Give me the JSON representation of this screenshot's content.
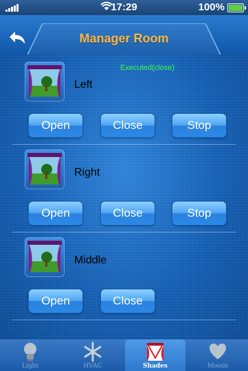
{
  "status_bar": {
    "time": "17:29",
    "battery": "100%"
  },
  "header": {
    "title": "Manager Room"
  },
  "status_message": "Executed(close)",
  "devices": [
    {
      "name": "Left",
      "buttons": [
        "Open",
        "Close",
        "Stop"
      ]
    },
    {
      "name": "Right",
      "buttons": [
        "Open",
        "Close",
        "Stop"
      ]
    },
    {
      "name": "Middle",
      "buttons": [
        "Open",
        "Close"
      ]
    }
  ],
  "tabs": [
    {
      "label": "Light",
      "icon": "lightbulb-icon"
    },
    {
      "label": "HVAC",
      "icon": "snowflake-icon"
    },
    {
      "label": "Shades",
      "icon": "curtain-icon",
      "active": true
    },
    {
      "label": "Moods",
      "icon": "heart-icon"
    }
  ],
  "colors": {
    "accent_title": "#ffb640",
    "status_message": "#3dff4c",
    "battery": "#5ed142"
  }
}
